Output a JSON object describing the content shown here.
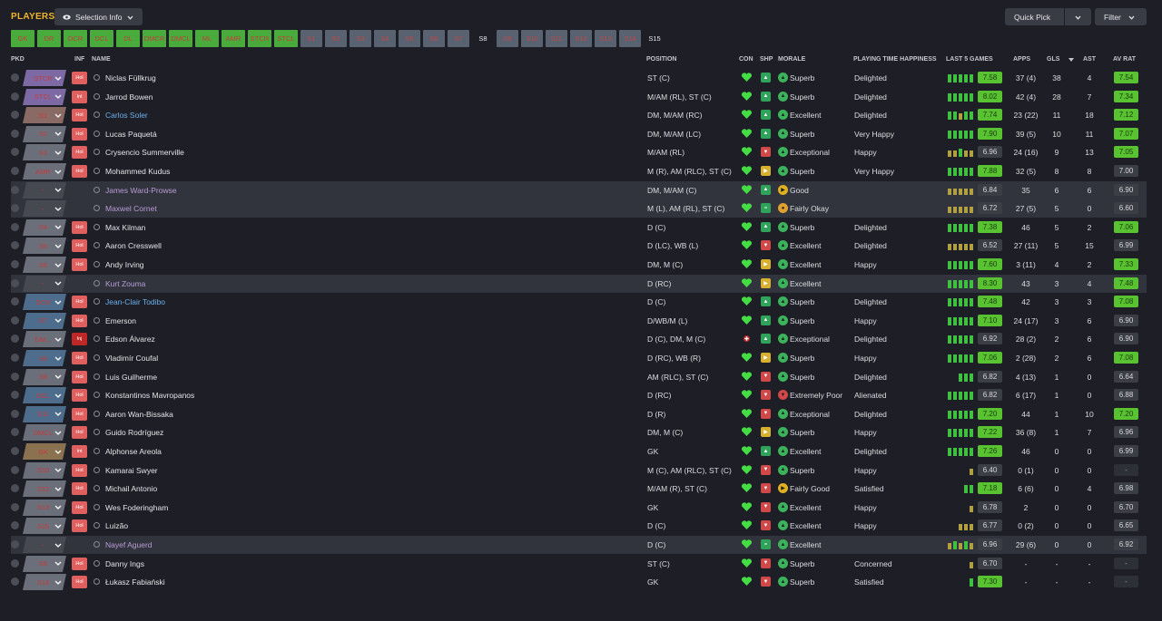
{
  "header": {
    "title": "PLAYERS",
    "selection_label": "Selection Info",
    "quick_pick_label": "Quick Pick",
    "filter_label": "Filter"
  },
  "position_tabs": [
    {
      "label": "GK",
      "style": "g"
    },
    {
      "label": "DR",
      "style": "g"
    },
    {
      "label": "DCR",
      "style": "g"
    },
    {
      "label": "DCL",
      "style": "g"
    },
    {
      "label": "DL",
      "style": "g"
    },
    {
      "label": "DMCR",
      "style": "g"
    },
    {
      "label": "DMCL",
      "style": "g"
    },
    {
      "label": "ML",
      "style": "g"
    },
    {
      "label": "AMR",
      "style": "g"
    },
    {
      "label": "STCR",
      "style": "g"
    },
    {
      "label": "STCL",
      "style": "g"
    },
    {
      "label": "S1",
      "style": "b"
    },
    {
      "label": "S2",
      "style": "b"
    },
    {
      "label": "S3",
      "style": "b"
    },
    {
      "label": "S4",
      "style": "b"
    },
    {
      "label": "S5",
      "style": "b"
    },
    {
      "label": "S6",
      "style": "b"
    },
    {
      "label": "S7",
      "style": "b"
    },
    {
      "label": "S8",
      "style": "t"
    },
    {
      "label": "S9",
      "style": "b"
    },
    {
      "label": "S10",
      "style": "b"
    },
    {
      "label": "S11",
      "style": "b"
    },
    {
      "label": "S12",
      "style": "b"
    },
    {
      "label": "S13",
      "style": "b"
    },
    {
      "label": "S14",
      "style": "b"
    },
    {
      "label": "S15",
      "style": "t"
    }
  ],
  "columns": {
    "pkd": "PKD",
    "inf": "INF",
    "name": "NAME",
    "position": "POSITION",
    "con": "CON",
    "shp": "SHP",
    "morale": "MORALE",
    "pth": "PLAYING TIME HAPPINESS",
    "last5": "LAST 5 GAMES",
    "apps": "APPS",
    "gls": "GLS",
    "ast": "AST",
    "avrat": "AV RAT"
  },
  "colors": {
    "accent": "#f0b52d",
    "rating_green": "#58c231",
    "heart_green": "#44dd44",
    "injury_red": "#c02828"
  },
  "players": [
    {
      "pkd": "STCR",
      "pkd_color": "#7d6aa4",
      "inf": "Hol",
      "name": "Niclas Füllkrug",
      "name_color": "white",
      "position": "ST (C)",
      "con": "heart",
      "shp": "up",
      "morale_icon": "up",
      "morale": "Superb",
      "pth": "Delighted",
      "bars": [
        3,
        3,
        3,
        3,
        3
      ],
      "last5": "7.58",
      "last5_style": "grn",
      "apps": "37 (4)",
      "gls": "38",
      "ast": "4",
      "avrat": "7.54",
      "avrat_style": "grn"
    },
    {
      "pkd": "STCL",
      "pkd_color": "#7d6aa4",
      "inf": "Int",
      "name": "Jarrod Bowen",
      "name_color": "white",
      "position": "M/AM (RL), ST (C)",
      "con": "heart",
      "shp": "up",
      "morale_icon": "up",
      "morale": "Superb",
      "pth": "Delighted",
      "bars": [
        3,
        3,
        3,
        3,
        3
      ],
      "last5": "8.02",
      "last5_style": "grn",
      "apps": "42 (4)",
      "gls": "28",
      "ast": "7",
      "avrat": "7.34",
      "avrat_style": "grn"
    },
    {
      "pkd": "S1",
      "pkd_color": "#8a6a64",
      "inf": "Hol",
      "name": "Carlos Soler",
      "name_color": "blue",
      "position": "DM, M/AM (RC)",
      "con": "heart",
      "shp": "up",
      "morale_icon": "up",
      "morale": "Excellent",
      "pth": "Delighted",
      "bars": [
        3,
        3,
        2,
        3,
        3
      ],
      "last5": "7.74",
      "last5_style": "grn",
      "apps": "23 (22)",
      "gls": "11",
      "ast": "18",
      "avrat": "7.12",
      "avrat_style": "grn"
    },
    {
      "pkd": "S2",
      "pkd_color": "#6b6f7a",
      "inf": "Hol",
      "name": "Lucas Paquetá",
      "name_color": "white",
      "position": "DM, M/AM (LC)",
      "con": "heart",
      "shp": "up",
      "morale_icon": "up",
      "morale": "Superb",
      "pth": "Very Happy",
      "bars": [
        3,
        3,
        3,
        3,
        3
      ],
      "last5": "7.90",
      "last5_style": "grn",
      "apps": "39 (5)",
      "gls": "10",
      "ast": "11",
      "avrat": "7.07",
      "avrat_style": "grn"
    },
    {
      "pkd": "S3",
      "pkd_color": "#6b6f7a",
      "inf": "Hol",
      "name": "Crysencio Summerville",
      "name_color": "white",
      "position": "M/AM (RL)",
      "con": "heart",
      "shp": "down",
      "morale_icon": "up",
      "morale": "Exceptional",
      "pth": "Happy",
      "bars": [
        2,
        2,
        3,
        2,
        2
      ],
      "last5": "6.96",
      "last5_style": "gry",
      "apps": "24 (16)",
      "gls": "9",
      "ast": "13",
      "avrat": "7.05",
      "avrat_style": "grn"
    },
    {
      "pkd": "AMR",
      "pkd_color": "#6b6f7a",
      "inf": "Hol",
      "name": "Mohammed Kudus",
      "name_color": "white",
      "position": "M (R), AM (RLC), ST (C)",
      "con": "heart",
      "shp": "side",
      "morale_icon": "up",
      "morale": "Superb",
      "pth": "Very Happy",
      "bars": [
        3,
        3,
        3,
        3,
        3
      ],
      "last5": "7.88",
      "last5_style": "grn",
      "apps": "32 (5)",
      "gls": "8",
      "ast": "8",
      "avrat": "7.00",
      "avrat_style": "gry"
    },
    {
      "pkd": "-",
      "pkd_color": "#464852",
      "inf": "",
      "name": "James Ward-Prowse",
      "name_color": "purp",
      "position": "DM, M/AM (C)",
      "con": "heart",
      "shp": "up",
      "morale_icon": "good",
      "morale": "Good",
      "pth": "",
      "bars": [
        2,
        2,
        2,
        2,
        2
      ],
      "last5": "6.84",
      "last5_style": "gry",
      "apps": "35",
      "gls": "6",
      "ast": "6",
      "avrat": "6.90",
      "avrat_style": "gry",
      "alt": true
    },
    {
      "pkd": "-",
      "pkd_color": "#464852",
      "inf": "",
      "name": "Maxwel Cornet",
      "name_color": "purp",
      "position": "M (L), AM (RL), ST (C)",
      "con": "heart",
      "shp": "eq",
      "morale_icon": "okay",
      "morale": "Fairly Okay",
      "pth": "",
      "bars": [
        2,
        2,
        2,
        2,
        2
      ],
      "last5": "6.72",
      "last5_style": "gry",
      "apps": "27 (5)",
      "gls": "5",
      "ast": "0",
      "avrat": "6.60",
      "avrat_style": "gry",
      "alt": true
    },
    {
      "pkd": "S4",
      "pkd_color": "#6b6f7a",
      "inf": "Hol",
      "name": "Max Kilman",
      "name_color": "white",
      "position": "D (C)",
      "con": "heart",
      "shp": "up",
      "morale_icon": "up",
      "morale": "Superb",
      "pth": "Delighted",
      "bars": [
        3,
        3,
        3,
        3,
        3
      ],
      "last5": "7.38",
      "last5_style": "grn",
      "apps": "46",
      "gls": "5",
      "ast": "2",
      "avrat": "7.06",
      "avrat_style": "grn"
    },
    {
      "pkd": "S5",
      "pkd_color": "#6b6f7a",
      "inf": "Hol",
      "name": "Aaron Cresswell",
      "name_color": "white",
      "position": "D (LC), WB (L)",
      "con": "heart",
      "shp": "down2",
      "morale_icon": "up",
      "morale": "Excellent",
      "pth": "Delighted",
      "bars": [
        2,
        2,
        2,
        2,
        2
      ],
      "last5": "6.52",
      "last5_style": "gry",
      "apps": "27 (11)",
      "gls": "5",
      "ast": "15",
      "avrat": "6.99",
      "avrat_style": "gry"
    },
    {
      "pkd": "S6",
      "pkd_color": "#6b6f7a",
      "inf": "Hol",
      "name": "Andy Irving",
      "name_color": "white",
      "position": "DM, M (C)",
      "con": "heart",
      "shp": "side",
      "morale_icon": "up",
      "morale": "Excellent",
      "pth": "Happy",
      "bars": [
        3,
        3,
        3,
        3,
        3
      ],
      "last5": "7.60",
      "last5_style": "grn",
      "apps": "3 (11)",
      "gls": "4",
      "ast": "2",
      "avrat": "7.33",
      "avrat_style": "grn"
    },
    {
      "pkd": "-",
      "pkd_color": "#464852",
      "inf": "",
      "name": "Kurt Zouma",
      "name_color": "purp",
      "position": "D (RC)",
      "con": "heart",
      "shp": "side",
      "morale_icon": "up",
      "morale": "Excellent",
      "pth": "",
      "bars": [
        3,
        3,
        3,
        3,
        3
      ],
      "last5": "8.30",
      "last5_style": "grn",
      "apps": "43",
      "gls": "3",
      "ast": "4",
      "avrat": "7.48",
      "avrat_style": "grn",
      "alt": true
    },
    {
      "pkd": "DCR",
      "pkd_color": "#4e6d8c",
      "inf": "Hol",
      "name": "Jean-Clair Todibo",
      "name_color": "blue",
      "position": "D (C)",
      "con": "heart",
      "shp": "up",
      "morale_icon": "up",
      "morale": "Superb",
      "pth": "Delighted",
      "bars": [
        3,
        3,
        3,
        3,
        3
      ],
      "last5": "7.48",
      "last5_style": "grn",
      "apps": "42",
      "gls": "3",
      "ast": "3",
      "avrat": "7.08",
      "avrat_style": "grn"
    },
    {
      "pkd": "S7",
      "pkd_color": "#4e6d8c",
      "inf": "Hol",
      "name": "Emerson",
      "name_color": "white",
      "position": "D/WB/M (L)",
      "con": "heart",
      "shp": "up",
      "morale_icon": "up",
      "morale": "Superb",
      "pth": "Happy",
      "bars": [
        3,
        3,
        3,
        3,
        3
      ],
      "last5": "7.10",
      "last5_style": "grn",
      "apps": "24 (17)",
      "gls": "3",
      "ast": "6",
      "avrat": "6.90",
      "avrat_style": "gry"
    },
    {
      "pkd": "DM...",
      "pkd_color": "#6b6f7a",
      "inf": "Inj",
      "name": "Edson Álvarez",
      "name_color": "white",
      "position": "D (C), DM, M (C)",
      "con": "injury",
      "shp": "up",
      "morale_icon": "up",
      "morale": "Exceptional",
      "pth": "Delighted",
      "bars": [
        3,
        3,
        3,
        3,
        3
      ],
      "last5": "6.92",
      "last5_style": "gry",
      "apps": "28 (2)",
      "gls": "2",
      "ast": "6",
      "avrat": "6.90",
      "avrat_style": "gry"
    },
    {
      "pkd": "S9",
      "pkd_color": "#4e6d8c",
      "inf": "Hol",
      "name": "Vladimír Coufal",
      "name_color": "white",
      "position": "D (RC), WB (R)",
      "con": "heart",
      "shp": "side",
      "morale_icon": "up",
      "morale": "Superb",
      "pth": "Happy",
      "bars": [
        3,
        3,
        3,
        3,
        3
      ],
      "last5": "7.06",
      "last5_style": "grn",
      "apps": "2 (28)",
      "gls": "2",
      "ast": "6",
      "avrat": "7.08",
      "avrat_style": "grn"
    },
    {
      "pkd": "S8",
      "pkd_color": "#6b6f7a",
      "inf": "Hol",
      "name": "Luis Guilherme",
      "name_color": "white",
      "position": "AM (RLC), ST (C)",
      "con": "heart",
      "shp": "down2",
      "morale_icon": "up",
      "morale": "Superb",
      "pth": "Delighted",
      "bars": [
        0,
        0,
        3,
        3,
        3
      ],
      "last5": "6.82",
      "last5_style": "gry",
      "apps": "4 (13)",
      "gls": "1",
      "ast": "0",
      "avrat": "6.64",
      "avrat_style": "gry"
    },
    {
      "pkd": "DCL",
      "pkd_color": "#4e6d8c",
      "inf": "Hol",
      "name": "Konstantinos Mavropanos",
      "name_color": "white",
      "position": "D (RC)",
      "con": "heart",
      "shp": "down2",
      "morale_icon": "bad",
      "morale": "Extremely Poor",
      "pth": "Alienated",
      "bars": [
        3,
        3,
        3,
        3,
        3
      ],
      "last5": "6.82",
      "last5_style": "gry",
      "apps": "6 (17)",
      "gls": "1",
      "ast": "0",
      "avrat": "6.88",
      "avrat_style": "gry"
    },
    {
      "pkd": "S11",
      "pkd_color": "#4e6d8c",
      "inf": "Hol",
      "name": "Aaron Wan-Bissaka",
      "name_color": "white",
      "position": "D (R)",
      "con": "heart",
      "shp": "down2",
      "morale_icon": "up",
      "morale": "Exceptional",
      "pth": "Delighted",
      "bars": [
        3,
        3,
        3,
        3,
        3
      ],
      "last5": "7.20",
      "last5_style": "grn",
      "apps": "44",
      "gls": "1",
      "ast": "10",
      "avrat": "7.20",
      "avrat_style": "grn"
    },
    {
      "pkd": "DMCL",
      "pkd_color": "#6b6f7a",
      "inf": "Hol",
      "name": "Guido Rodríguez",
      "name_color": "white",
      "position": "DM, M (C)",
      "con": "heart",
      "shp": "side",
      "morale_icon": "up",
      "morale": "Superb",
      "pth": "Happy",
      "bars": [
        3,
        3,
        3,
        3,
        3
      ],
      "last5": "7.22",
      "last5_style": "grn",
      "apps": "36 (8)",
      "gls": "1",
      "ast": "7",
      "avrat": "6.96",
      "avrat_style": "gry"
    },
    {
      "pkd": "GK",
      "pkd_color": "#8a7250",
      "inf": "Int",
      "name": "Alphonse Areola",
      "name_color": "white",
      "position": "GK",
      "con": "heart",
      "shp": "up",
      "morale_icon": "up",
      "morale": "Excellent",
      "pth": "Delighted",
      "bars": [
        3,
        3,
        3,
        3,
        3
      ],
      "last5": "7.26",
      "last5_style": "grn",
      "apps": "46",
      "gls": "0",
      "ast": "0",
      "avrat": "6.99",
      "avrat_style": "gry"
    },
    {
      "pkd": "S10",
      "pkd_color": "#6b6f7a",
      "inf": "Hol",
      "name": "Kamarai Swyer",
      "name_color": "white",
      "position": "M (C), AM (RLC), ST (C)",
      "con": "heart",
      "shp": "down2",
      "morale_icon": "up",
      "morale": "Superb",
      "pth": "Happy",
      "bars": [
        0,
        0,
        0,
        0,
        2
      ],
      "last5": "6.40",
      "last5_style": "gry",
      "apps": "0 (1)",
      "gls": "0",
      "ast": "0",
      "avrat": "-",
      "avrat_style": "dash"
    },
    {
      "pkd": "S12",
      "pkd_color": "#6b6f7a",
      "inf": "Hol",
      "name": "Michail Antonio",
      "name_color": "white",
      "position": "M/AM (R), ST (C)",
      "con": "heart",
      "shp": "down2",
      "morale_icon": "good",
      "morale": "Fairly Good",
      "pth": "Satisfied",
      "bars": [
        0,
        0,
        0,
        3,
        3
      ],
      "last5": "7.18",
      "last5_style": "grn",
      "apps": "6 (6)",
      "gls": "0",
      "ast": "4",
      "avrat": "6.98",
      "avrat_style": "gry"
    },
    {
      "pkd": "S13",
      "pkd_color": "#6b6f7a",
      "inf": "Hol",
      "name": "Wes Foderingham",
      "name_color": "white",
      "position": "GK",
      "con": "heart",
      "shp": "down2",
      "morale_icon": "up",
      "morale": "Excellent",
      "pth": "Happy",
      "bars": [
        0,
        0,
        0,
        0,
        2
      ],
      "last5": "6.78",
      "last5_style": "gry",
      "apps": "2",
      "gls": "0",
      "ast": "0",
      "avrat": "6.70",
      "avrat_style": "gry"
    },
    {
      "pkd": "S15",
      "pkd_color": "#6b6f7a",
      "inf": "Hol",
      "name": "Luizão",
      "name_color": "white",
      "position": "D (C)",
      "con": "heart",
      "shp": "down2",
      "morale_icon": "up",
      "morale": "Excellent",
      "pth": "Happy",
      "bars": [
        0,
        0,
        2,
        2,
        2
      ],
      "last5": "6.77",
      "last5_style": "gry",
      "apps": "0 (2)",
      "gls": "0",
      "ast": "0",
      "avrat": "6.65",
      "avrat_style": "gry"
    },
    {
      "pkd": "-",
      "pkd_color": "#464852",
      "inf": "",
      "name": "Nayef Aguerd",
      "name_color": "purp",
      "position": "D (C)",
      "con": "heart",
      "shp": "eq",
      "morale_icon": "up",
      "morale": "Excellent",
      "pth": "",
      "bars": [
        2,
        3,
        2,
        3,
        2
      ],
      "last5": "6.96",
      "last5_style": "gry",
      "apps": "29 (6)",
      "gls": "0",
      "ast": "0",
      "avrat": "6.92",
      "avrat_style": "gry",
      "alt": true
    },
    {
      "pkd": "S6",
      "pkd_color": "#6b6f7a",
      "inf": "Hol",
      "name": "Danny Ings",
      "name_color": "white",
      "position": "ST (C)",
      "con": "heart",
      "shp": "down2",
      "morale_icon": "up",
      "morale": "Superb",
      "pth": "Concerned",
      "bars": [
        0,
        0,
        0,
        0,
        2
      ],
      "last5": "6.70",
      "last5_style": "gry",
      "apps": "-",
      "gls": "-",
      "ast": "-",
      "avrat": "-",
      "avrat_style": "dash"
    },
    {
      "pkd": "S14",
      "pkd_color": "#6b6f7a",
      "inf": "Hol",
      "name": "Łukasz Fabiański",
      "name_color": "white",
      "position": "GK",
      "con": "heart",
      "shp": "down2",
      "morale_icon": "up",
      "morale": "Superb",
      "pth": "Satisfied",
      "bars": [
        0,
        0,
        0,
        0,
        3
      ],
      "last5": "7.30",
      "last5_style": "grn",
      "apps": "-",
      "gls": "-",
      "ast": "-",
      "avrat": "-",
      "avrat_style": "dash"
    }
  ]
}
